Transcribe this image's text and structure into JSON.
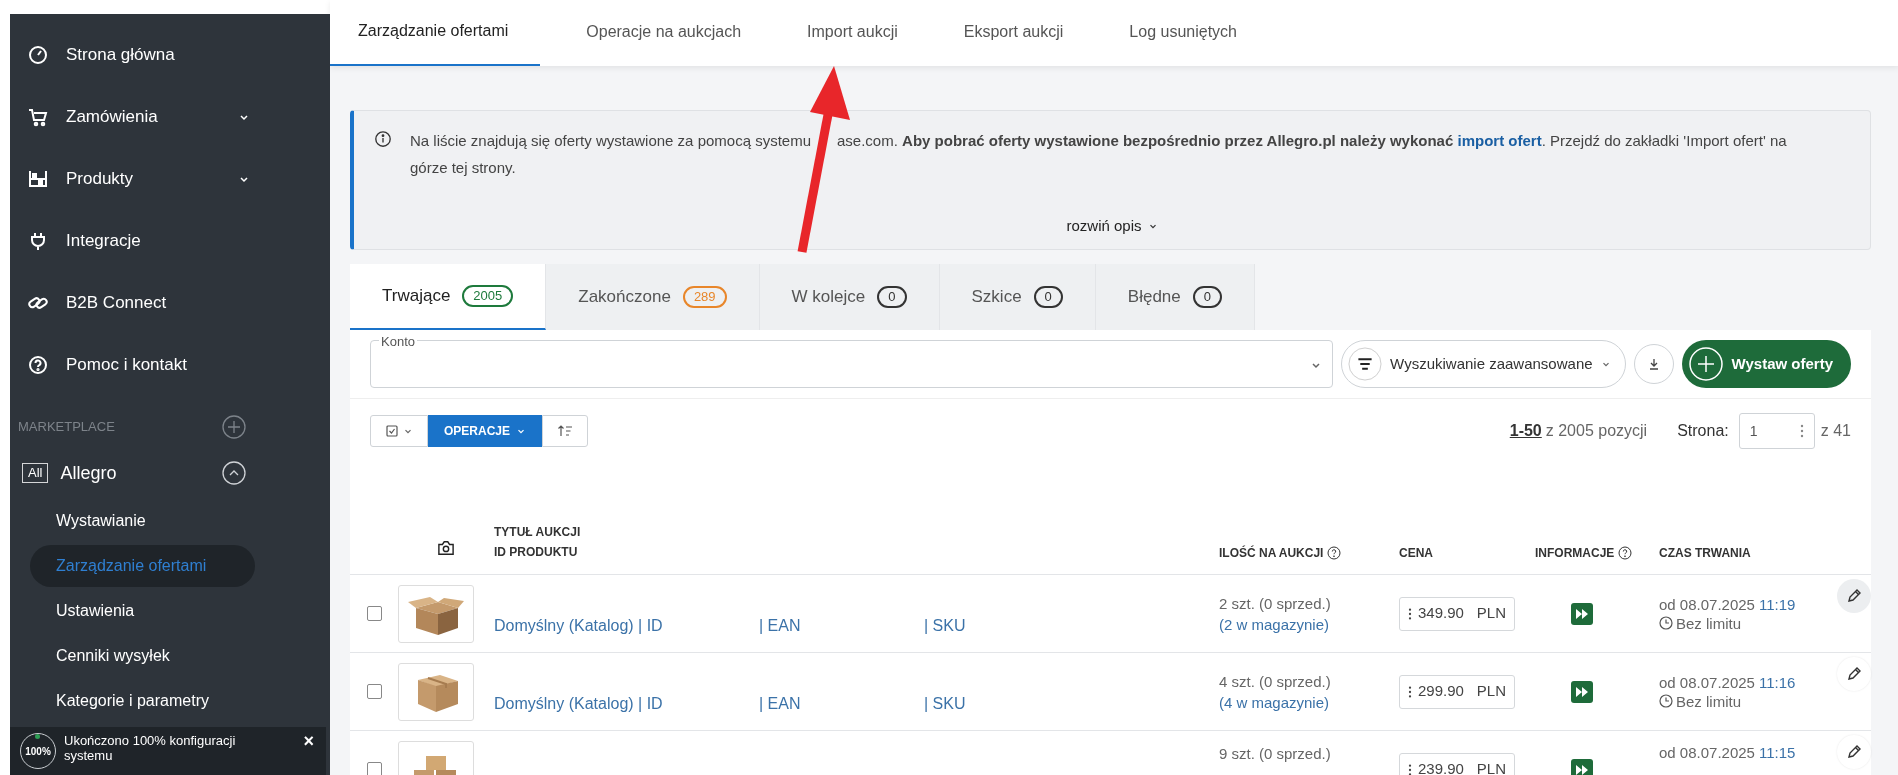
{
  "sidebar": {
    "nav": [
      {
        "label": "Strona główna",
        "expandable": false
      },
      {
        "label": "Zamówienia",
        "expandable": true
      },
      {
        "label": "Produkty",
        "expandable": true
      },
      {
        "label": "Integracje",
        "expandable": false
      },
      {
        "label": "B2B Connect",
        "expandable": false
      },
      {
        "label": "Pomoc i kontakt",
        "expandable": false
      }
    ],
    "section": {
      "label": "MARKETPLACE"
    },
    "account": {
      "badge": "All",
      "name": "Allegro",
      "expanded": true
    },
    "subitems": [
      {
        "label": "Wystawianie",
        "selected": false
      },
      {
        "label": "Zarządzanie ofertami",
        "selected": true
      },
      {
        "label": "Ustawienia",
        "selected": false
      },
      {
        "label": "Cenniki wysyłek",
        "selected": false
      },
      {
        "label": "Kategorie i parametry",
        "selected": false
      }
    ],
    "notice": {
      "badge": "100%",
      "text": "Ukończono 100% konfiguracji systemu",
      "close": "×"
    }
  },
  "top_tabs": [
    {
      "label": "Zarządzanie ofertami",
      "selected": true
    },
    {
      "label": "Operacje na aukcjach",
      "selected": false
    },
    {
      "label": "Import aukcji",
      "selected": false
    },
    {
      "label": "Eksport aukcji",
      "selected": false
    },
    {
      "label": "Log usuniętych",
      "selected": false
    }
  ],
  "annotation": {
    "kind": "arrow"
  },
  "info": {
    "text_before": "Na liście znajdują się oferty wystawione za pomocą systemu",
    "text_before_2": "ase.com. **Aby pobrać oferty wystawione bezpośrednio przez Allegro.pl należy wykonać**",
    "link": "import ofert",
    "text_after": ". Przejdź do zakładki 'Import ofert' na górze tej strony.",
    "toggle": "rozwiń opis"
  },
  "status_tabs": [
    {
      "label": "Trwające",
      "count": "2005",
      "color": "#1e7a3c",
      "selected": true
    },
    {
      "label": "Zakończone",
      "count": "289",
      "color": "#e8862a",
      "selected": false
    },
    {
      "label": "W kolejce",
      "count": "0",
      "color": "#333333",
      "selected": false
    },
    {
      "label": "Szkice",
      "count": "0",
      "color": "#333333",
      "selected": false
    },
    {
      "label": "Błędne",
      "count": "0",
      "color": "#333333",
      "selected": false
    }
  ],
  "filters": {
    "account_label": "Konto",
    "advanced": "Wyszukiwanie zaawansowane",
    "add_button": "Wystaw oferty"
  },
  "toolbar": {
    "operations": "OPERACJE",
    "range": "1-50",
    "total": "z 2005 pozycji",
    "page_label": "Strona:",
    "page_value": "1",
    "page_total": "z 41"
  },
  "table": {
    "columns": [
      {
        "kind": "photo"
      },
      {
        "kind": "title",
        "label": "TYTUŁ AUKCJI",
        "label2": "ID PRODUKTU"
      },
      {
        "kind": "quantity",
        "label": "ILOŚĆ NA AUKCJI",
        "help": true
      },
      {
        "kind": "price",
        "label": "CENA",
        "help": false
      },
      {
        "kind": "info",
        "label": "INFORMACJE",
        "help": true
      },
      {
        "kind": "duration",
        "label": "CZAS TRWANIA",
        "help": false
      }
    ],
    "rows": [
      {
        "checked": false,
        "title_parts": [
          "Domyślny (Katalog) | ID",
          "| EAN",
          "| SKU"
        ],
        "quantity": "2 szt. (0 sprzed.)",
        "stock": "(2 w magazynie)",
        "price": "349.90",
        "currency": "PLN",
        "date": "od 08.07.2025",
        "time": "11:19",
        "duration": "Bez limitu"
      },
      {
        "checked": false,
        "title_parts": [
          "Domyślny (Katalog) | ID",
          "| EAN",
          "| SKU"
        ],
        "quantity": "4 szt. (0 sprzed.)",
        "stock": "(4 w magazynie)",
        "price": "299.90",
        "currency": "PLN",
        "date": "od 08.07.2025",
        "time": "11:16",
        "duration": "Bez limitu"
      },
      {
        "checked": false,
        "title_parts": [],
        "quantity": "9 szt. (0 sprzed.)",
        "price": "239.90",
        "currency": "PLN",
        "date": "od 08.07.2025",
        "time": "11:15"
      }
    ]
  }
}
